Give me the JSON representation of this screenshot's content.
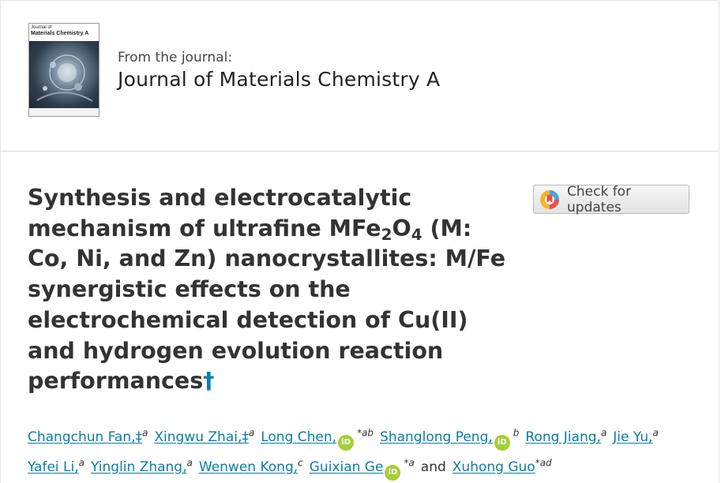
{
  "journal": {
    "from_label": "From the journal:",
    "name": "Journal of Materials Chemistry A",
    "cover": {
      "line1": "Journal of",
      "line2": "Materials Chemistry A"
    }
  },
  "article": {
    "title_part1": "Synthesis and electrocatalytic mechanism of ultrafine MFe",
    "sub1": "2",
    "title_part2": "O",
    "sub2": "4",
    "title_part3": " (M: Co, Ni, and Zn) nanocrystallites: M/Fe synergistic effects on the electrochemical detection of Cu(II) and hydrogen evolution reaction performances",
    "dagger": "†"
  },
  "check_updates": {
    "label": "Check for updates"
  },
  "orcid_label": "iD",
  "authors_line1": [
    {
      "name": "Changchun Fan",
      "suffix": ",‡",
      "aff": "a",
      "orcid": false
    },
    {
      "name": "Xingwu Zhai",
      "suffix": ",‡",
      "aff": "a",
      "orcid": false
    },
    {
      "name": "Long Chen",
      "suffix": ",",
      "aff": "*ab",
      "orcid": true
    },
    {
      "name": "Shanglong Peng",
      "suffix": ",",
      "aff": "b",
      "orcid": true
    },
    {
      "name": "Rong Jiang",
      "suffix": ",",
      "aff": "a",
      "orcid": false
    },
    {
      "name": "Jie Yu",
      "suffix": ",",
      "aff": "a",
      "orcid": false
    }
  ],
  "authors_line2": [
    {
      "name": "Yafei Li",
      "suffix": ",",
      "aff": "a",
      "orcid": false
    },
    {
      "name": "Yinglin Zhang",
      "suffix": ",",
      "aff": "a",
      "orcid": false
    },
    {
      "name": "Wenwen Kong",
      "suffix": ",",
      "aff": "c",
      "orcid": false
    },
    {
      "name": "Guixian Ge",
      "suffix": "",
      "aff": "*a",
      "orcid": true
    },
    {
      "connector": "and"
    },
    {
      "name": "Xuhong Guo",
      "suffix": "",
      "aff": "*ad",
      "orcid": false
    }
  ]
}
